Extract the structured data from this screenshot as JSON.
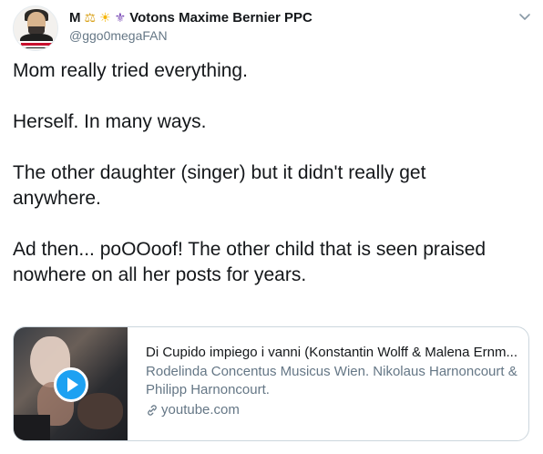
{
  "user": {
    "display_name": "M",
    "emoji": [
      "⚖",
      "☀",
      "⚜"
    ],
    "name_suffix": "Votons Maxime Bernier PPC",
    "handle": "@ggo0megaFAN"
  },
  "tweet": {
    "paragraphs": [
      "Mom really tried everything.",
      "Herself. In many ways.",
      "The other daughter (singer) but it didn't really get anywhere.",
      "Ad then... poOOoof! The other child that is seen praised nowhere on all her posts for years."
    ]
  },
  "card": {
    "title": "Di Cupido impiego i vanni (Konstantin Wolff & Malena Ernm...",
    "description": "Rodelinda Concentus Musicus Wien. Nikolaus Harnoncourt & Philipp Harnoncourt.",
    "domain": "youtube.com",
    "play_color": "#1da1f2"
  },
  "icons": {
    "menu": "chevron-down-icon",
    "link": "link-icon",
    "play": "play-icon"
  }
}
